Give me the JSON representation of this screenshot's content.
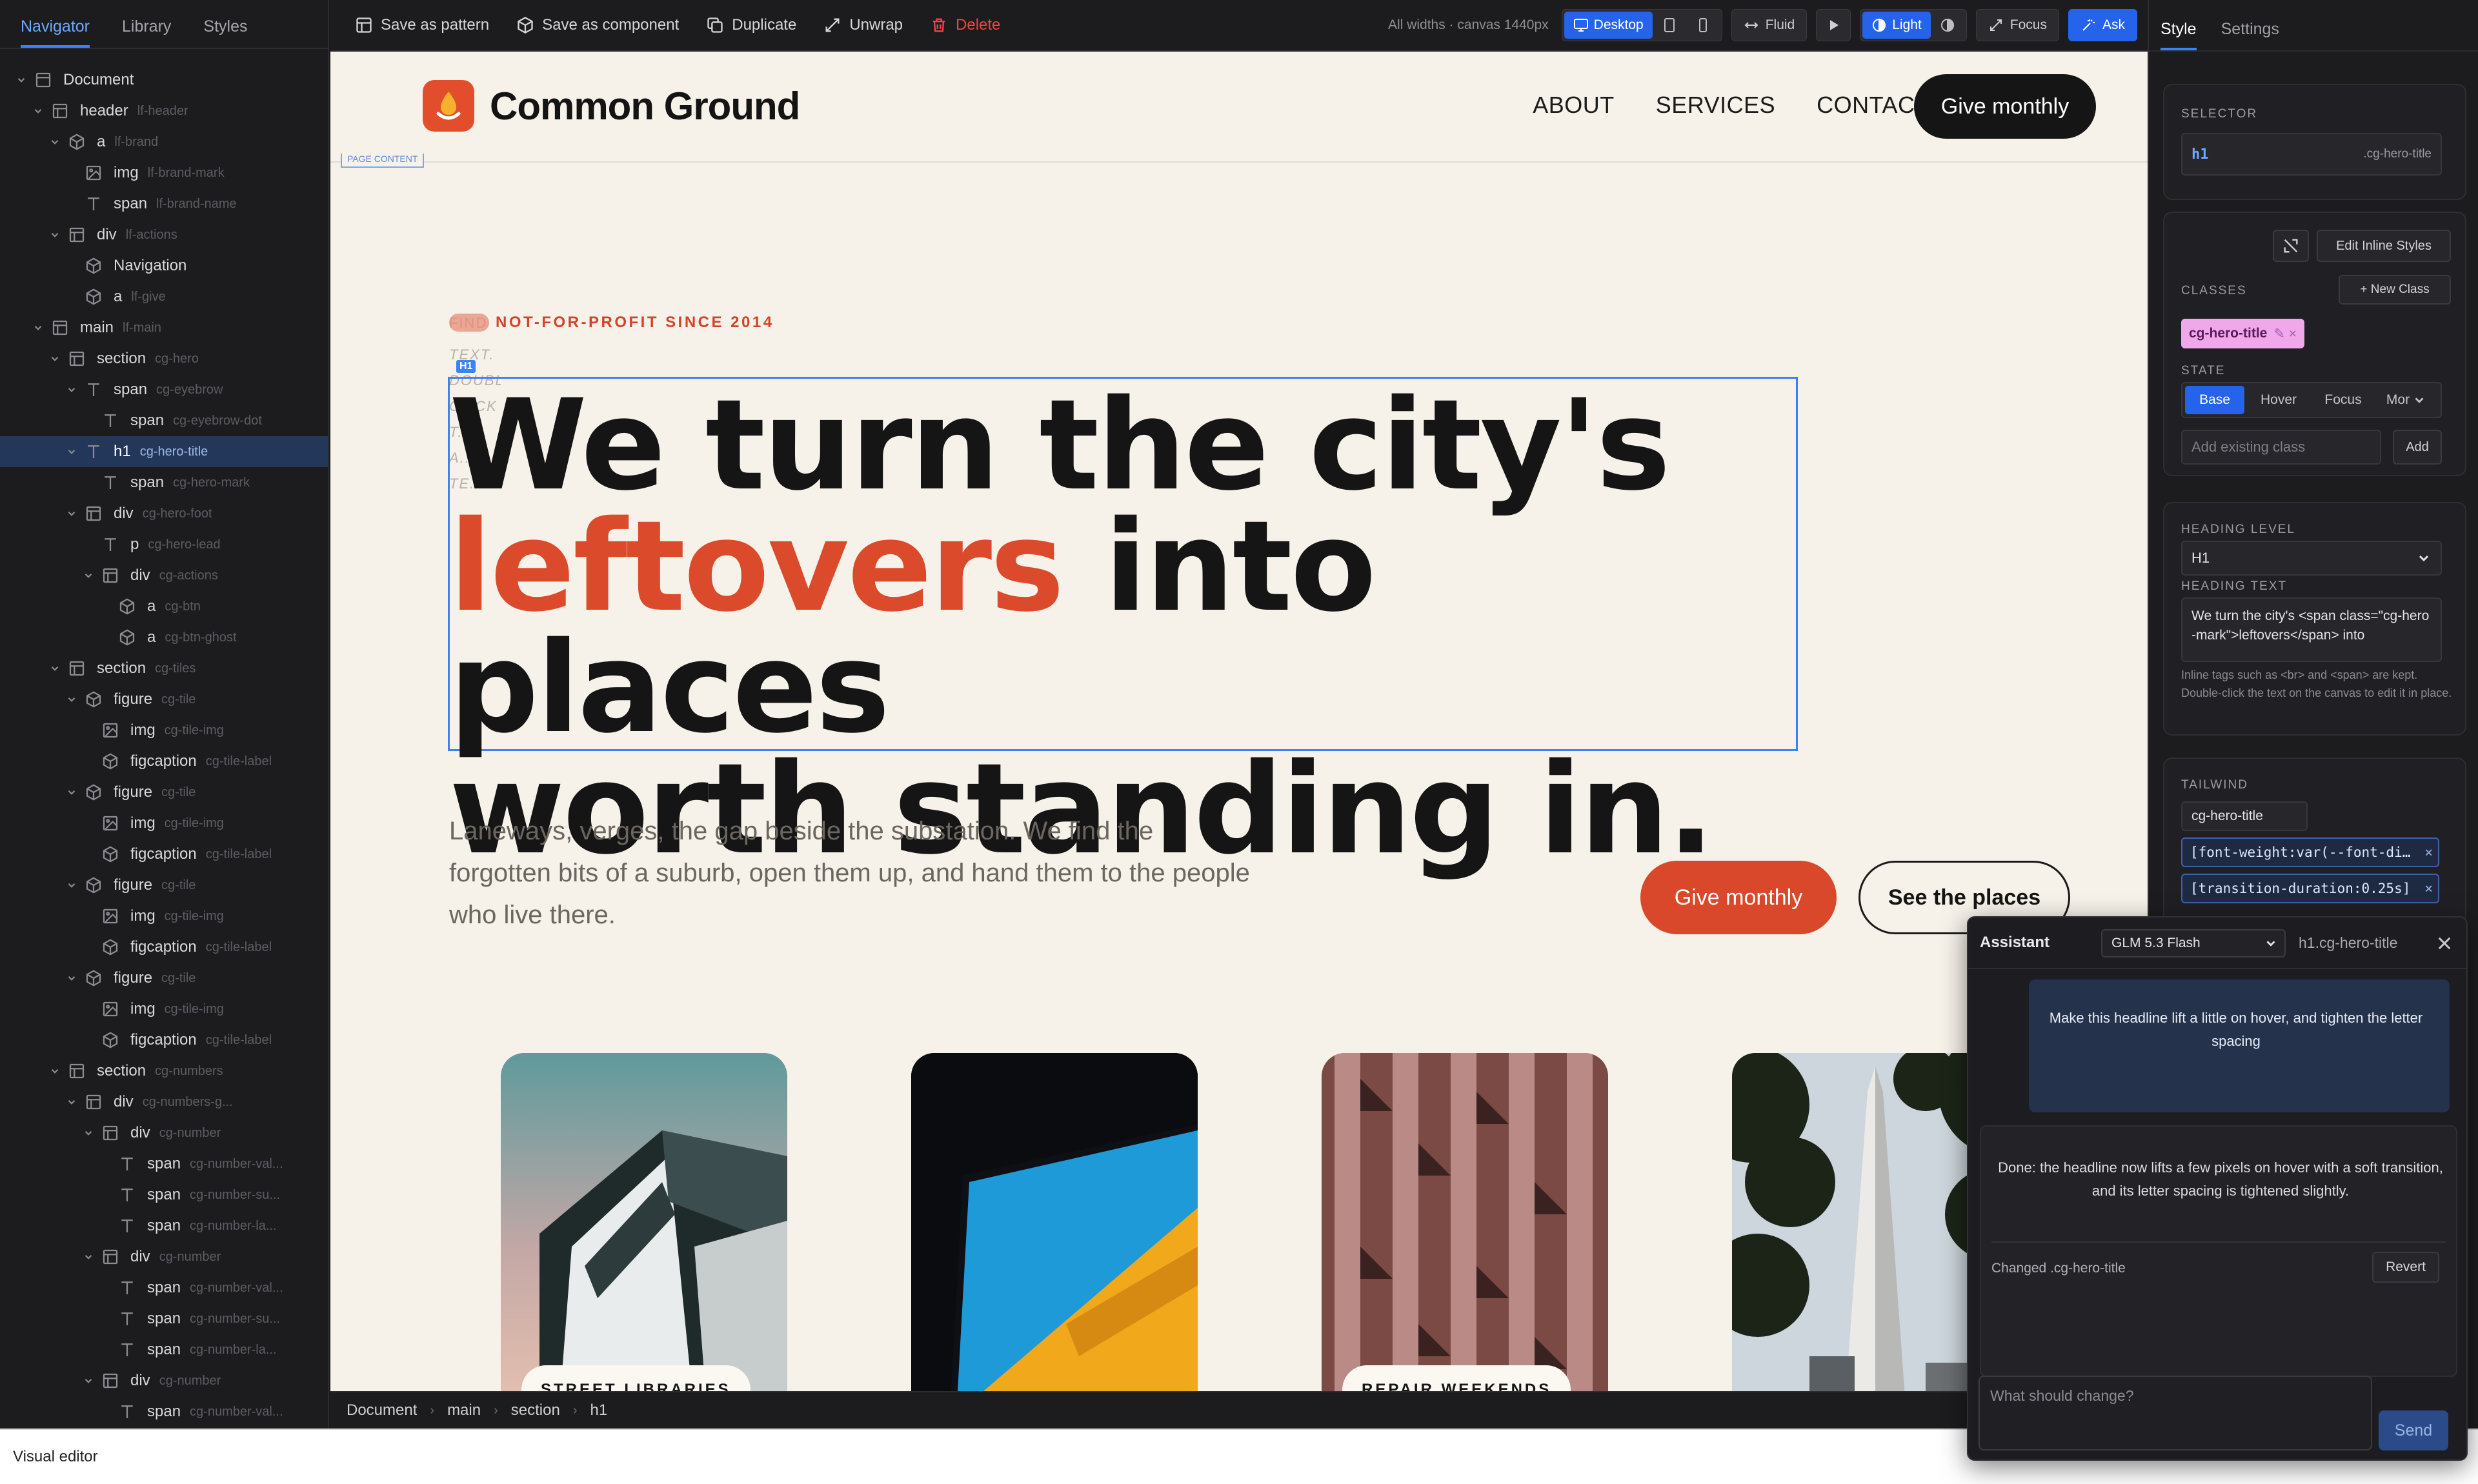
{
  "navigator": {
    "tabs": [
      "Navigator",
      "Library",
      "Styles"
    ],
    "tree": [
      {
        "tag": "Document",
        "cls": "",
        "depth": 0,
        "icon": "page-icon",
        "chevron": "down"
      },
      {
        "tag": "header",
        "cls": "lf-header",
        "depth": 1,
        "icon": "box-icon",
        "chevron": "down"
      },
      {
        "tag": "a",
        "cls": "lf-brand",
        "depth": 2,
        "icon": "component-icon",
        "chevron": "down"
      },
      {
        "tag": "img",
        "cls": "lf-brand-mark",
        "depth": 3,
        "icon": "image-icon",
        "chevron": ""
      },
      {
        "tag": "span",
        "cls": "lf-brand-name",
        "depth": 3,
        "icon": "text-icon",
        "chevron": ""
      },
      {
        "tag": "div",
        "cls": "lf-actions",
        "depth": 2,
        "icon": "box-icon",
        "chevron": "down"
      },
      {
        "tag": "Navigation",
        "cls": "",
        "depth": 3,
        "icon": "component-icon",
        "chevron": ""
      },
      {
        "tag": "a",
        "cls": "lf-give",
        "depth": 3,
        "icon": "component-icon",
        "chevron": ""
      },
      {
        "tag": "main",
        "cls": "lf-main",
        "depth": 1,
        "icon": "box-icon",
        "chevron": "down"
      },
      {
        "tag": "section",
        "cls": "cg-hero",
        "depth": 2,
        "icon": "box-icon",
        "chevron": "down"
      },
      {
        "tag": "span",
        "cls": "cg-eyebrow",
        "depth": 3,
        "icon": "text-icon",
        "chevron": "down"
      },
      {
        "tag": "span",
        "cls": "cg-eyebrow-dot",
        "depth": 4,
        "icon": "text-icon",
        "chevron": ""
      },
      {
        "tag": "h1",
        "cls": "cg-hero-title",
        "depth": 3,
        "icon": "text-icon",
        "chevron": "down",
        "selected": true
      },
      {
        "tag": "span",
        "cls": "cg-hero-mark",
        "depth": 4,
        "icon": "text-icon",
        "chevron": ""
      },
      {
        "tag": "div",
        "cls": "cg-hero-foot",
        "depth": 3,
        "icon": "box-icon",
        "chevron": "down"
      },
      {
        "tag": "p",
        "cls": "cg-hero-lead",
        "depth": 4,
        "icon": "text-icon",
        "chevron": ""
      },
      {
        "tag": "div",
        "cls": "cg-actions",
        "depth": 4,
        "icon": "box-icon",
        "chevron": "down"
      },
      {
        "tag": "a",
        "cls": "cg-btn",
        "depth": 5,
        "icon": "component-icon",
        "chevron": ""
      },
      {
        "tag": "a",
        "cls": "cg-btn-ghost",
        "depth": 5,
        "icon": "component-icon",
        "chevron": ""
      },
      {
        "tag": "section",
        "cls": "cg-tiles",
        "depth": 2,
        "icon": "box-icon",
        "chevron": "down"
      },
      {
        "tag": "figure",
        "cls": "cg-tile",
        "depth": 3,
        "icon": "component-icon",
        "chevron": "down"
      },
      {
        "tag": "img",
        "cls": "cg-tile-img",
        "depth": 4,
        "icon": "image-icon",
        "chevron": ""
      },
      {
        "tag": "figcaption",
        "cls": "cg-tile-label",
        "depth": 4,
        "icon": "component-icon",
        "chevron": ""
      },
      {
        "tag": "figure",
        "cls": "cg-tile",
        "depth": 3,
        "icon": "component-icon",
        "chevron": "down"
      },
      {
        "tag": "img",
        "cls": "cg-tile-img",
        "depth": 4,
        "icon": "image-icon",
        "chevron": ""
      },
      {
        "tag": "figcaption",
        "cls": "cg-tile-label",
        "depth": 4,
        "icon": "component-icon",
        "chevron": ""
      },
      {
        "tag": "figure",
        "cls": "cg-tile",
        "depth": 3,
        "icon": "component-icon",
        "chevron": "down"
      },
      {
        "tag": "img",
        "cls": "cg-tile-img",
        "depth": 4,
        "icon": "image-icon",
        "chevron": ""
      },
      {
        "tag": "figcaption",
        "cls": "cg-tile-label",
        "depth": 4,
        "icon": "component-icon",
        "chevron": ""
      },
      {
        "tag": "figure",
        "cls": "cg-tile",
        "depth": 3,
        "icon": "component-icon",
        "chevron": "down"
      },
      {
        "tag": "img",
        "cls": "cg-tile-img",
        "depth": 4,
        "icon": "image-icon",
        "chevron": ""
      },
      {
        "tag": "figcaption",
        "cls": "cg-tile-label",
        "depth": 4,
        "icon": "component-icon",
        "chevron": ""
      },
      {
        "tag": "section",
        "cls": "cg-numbers",
        "depth": 2,
        "icon": "box-icon",
        "chevron": "down"
      },
      {
        "tag": "div",
        "cls": "cg-numbers-g...",
        "depth": 3,
        "icon": "box-icon",
        "chevron": "down"
      },
      {
        "tag": "div",
        "cls": "cg-number",
        "depth": 4,
        "icon": "box-icon",
        "chevron": "down"
      },
      {
        "tag": "span",
        "cls": "cg-number-val...",
        "depth": 5,
        "icon": "text-icon",
        "chevron": ""
      },
      {
        "tag": "span",
        "cls": "cg-number-su...",
        "depth": 5,
        "icon": "text-icon",
        "chevron": ""
      },
      {
        "tag": "span",
        "cls": "cg-number-la...",
        "depth": 5,
        "icon": "text-icon",
        "chevron": ""
      },
      {
        "tag": "div",
        "cls": "cg-number",
        "depth": 4,
        "icon": "box-icon",
        "chevron": "down"
      },
      {
        "tag": "span",
        "cls": "cg-number-val...",
        "depth": 5,
        "icon": "text-icon",
        "chevron": ""
      },
      {
        "tag": "span",
        "cls": "cg-number-su...",
        "depth": 5,
        "icon": "text-icon",
        "chevron": ""
      },
      {
        "tag": "span",
        "cls": "cg-number-la...",
        "depth": 5,
        "icon": "text-icon",
        "chevron": ""
      },
      {
        "tag": "div",
        "cls": "cg-number",
        "depth": 4,
        "icon": "box-icon",
        "chevron": "down"
      },
      {
        "tag": "span",
        "cls": "cg-number-val...",
        "depth": 5,
        "icon": "text-icon",
        "chevron": ""
      }
    ]
  },
  "toolbar": {
    "save_pattern": "Save as pattern",
    "save_component": "Save as component",
    "duplicate": "Duplicate",
    "unwrap": "Unwrap",
    "delete": "Delete",
    "viewport_info": "All widths · canvas 1440px",
    "desktop": "Desktop",
    "fluid": "Fluid",
    "light": "Light",
    "focus": "Focus",
    "ask": "Ask"
  },
  "site": {
    "brand_name": "Common Ground",
    "nav": [
      "ABOUT",
      "SERVICES",
      "CONTACT"
    ],
    "give_top": "Give monthly",
    "page_content_tag": "PAGE CONTENT",
    "eyebrow_dot": "FIND",
    "eyebrow": "NOT-FOR-PROFIT SINCE 2014",
    "ghost_text": "TEXT. DOUBLE- CLICK T... A... TE...",
    "h1_badge": "H1",
    "hero_title_1": "We turn the city's",
    "hero_title_mark": "leftovers",
    "hero_title_2": " into places",
    "hero_title_3": "worth standing in.",
    "hero_lead": "Laneways, verges, the gap beside the substation. We find the forgotten bits of a suburb, open them up, and hand them to the people who live there.",
    "give_main": "Give monthly",
    "see_places": "See the places",
    "tiles": [
      "STREET LIBRARIES",
      "",
      "REPAIR WEEKENDS",
      ""
    ]
  },
  "breadcrumb": [
    "Document",
    "main",
    "section",
    "h1"
  ],
  "status": {
    "title": "Visual editor"
  },
  "inspector": {
    "tabs": [
      "Style",
      "Settings"
    ],
    "selector_label": "SELECTOR",
    "selector_tag": "h1",
    "selector_class": ".cg-hero-title",
    "edit_inline": "Edit Inline Styles",
    "classes_label": "CLASSES",
    "new_class": "+ New Class",
    "class_chip": "cg-hero-title",
    "state_label": "STATE",
    "states": [
      "Base",
      "Hover",
      "Focus",
      "Mor"
    ],
    "add_class_placeholder": "Add existing class",
    "add_btn": "Add",
    "heading_level_label": "HEADING LEVEL",
    "heading_level": "H1",
    "heading_text_label": "HEADING TEXT",
    "heading_text": "We turn the city's <span class=\"cg-hero-mark\">leftovers</span> into",
    "heading_hint": "Inline tags such as <br> and <span> are kept. Double-click the text on the canvas to edit it in place.",
    "tailwind_label": "TAILWIND",
    "tailwind_class": "cg-hero-title",
    "tw_tokens": [
      "[font-weight:var(--font-di…",
      "[transition-duration:0.25s]"
    ]
  },
  "assistant": {
    "title": "Assistant",
    "model": "GLM 5.3 Flash",
    "target": "h1.cg-hero-title",
    "user_msg": "Make this headline lift a little on hover, and tighten the letter spacing",
    "ai_msg": "Done: the headline now lifts a few pixels on hover with a soft transition, and its letter spacing is tightened slightly.",
    "changed": "Changed .cg-hero-title",
    "revert": "Revert",
    "input_placeholder": "What should change?",
    "send": "Send"
  },
  "colors": {
    "accent": "#3b82f6",
    "brand": "#e24e2b",
    "mark": "#dc4a2c",
    "canvas": "#f6f2ea"
  }
}
